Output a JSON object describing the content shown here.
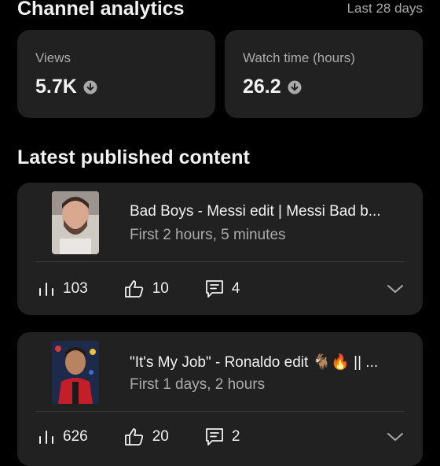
{
  "header": {
    "title": "Channel analytics",
    "period": "Last 28 days"
  },
  "stats": [
    {
      "label": "Views",
      "value": "5.7K",
      "trend_icon": "arrow-down-circle-icon"
    },
    {
      "label": "Watch time (hours)",
      "value": "26.2",
      "trend_icon": "arrow-down-circle-icon"
    }
  ],
  "section": {
    "title": "Latest published content"
  },
  "videos": [
    {
      "title": "Bad Boys - Messi edit | Messi Bad b...",
      "subtitle": "First 2 hours, 5 minutes",
      "views": "103",
      "likes": "10",
      "comments": "4"
    },
    {
      "title": "\"It's My Job\" - Ronaldo edit 🐐🔥 || ...",
      "subtitle": "First 1 days, 2 hours",
      "views": "626",
      "likes": "20",
      "comments": "2"
    }
  ],
  "colors": {
    "background": "#000000",
    "card": "#212121",
    "text_primary": "#f1f1f1",
    "text_secondary": "#aaaaaa",
    "divider": "#3d3d3d"
  }
}
